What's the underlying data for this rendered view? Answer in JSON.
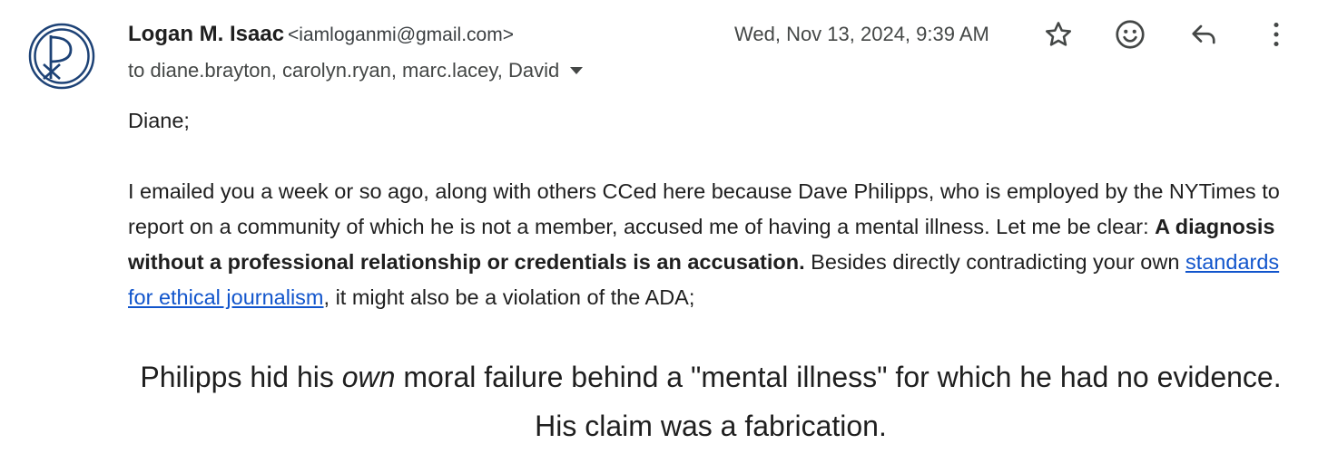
{
  "sender": {
    "name": "Logan M. Isaac",
    "email": "<iamloganmi@gmail.com>",
    "avatar_color": "#1d4276"
  },
  "recipients": {
    "line": "to diane.brayton, carolyn.ryan, marc.lacey, David"
  },
  "date": "Wed, Nov 13, 2024, 9:39 AM",
  "actions": [
    {
      "icon": "star-icon"
    },
    {
      "icon": "emoji-icon"
    },
    {
      "icon": "reply-icon"
    },
    {
      "icon": "more-vert-icon"
    }
  ],
  "body": {
    "greeting": "Diane;",
    "p1_part1": "I emailed you a week or so ago, along with others CCed here because Dave Philipps, who is employed by the NYTimes to report on a community of which he is not a member, accused me of having a mental illness. Let me be clear: ",
    "p1_bold": "A diagnosis without a professional relationship or credentials is an accusation.",
    "p1_part2": " Besides directly contradicting your own ",
    "p1_link": "standards for ethical journalism",
    "p1_part3": ", it might also be a violation of the ADA;",
    "quote_part1": "Philipps hid his ",
    "quote_em": "own",
    "quote_part2": " moral failure behind a \"mental illness\" for which he had no evidence. His claim was a fabrication."
  },
  "colors": {
    "link": "#1155cc",
    "text": "#1f1f1f",
    "secondary": "#444746"
  }
}
